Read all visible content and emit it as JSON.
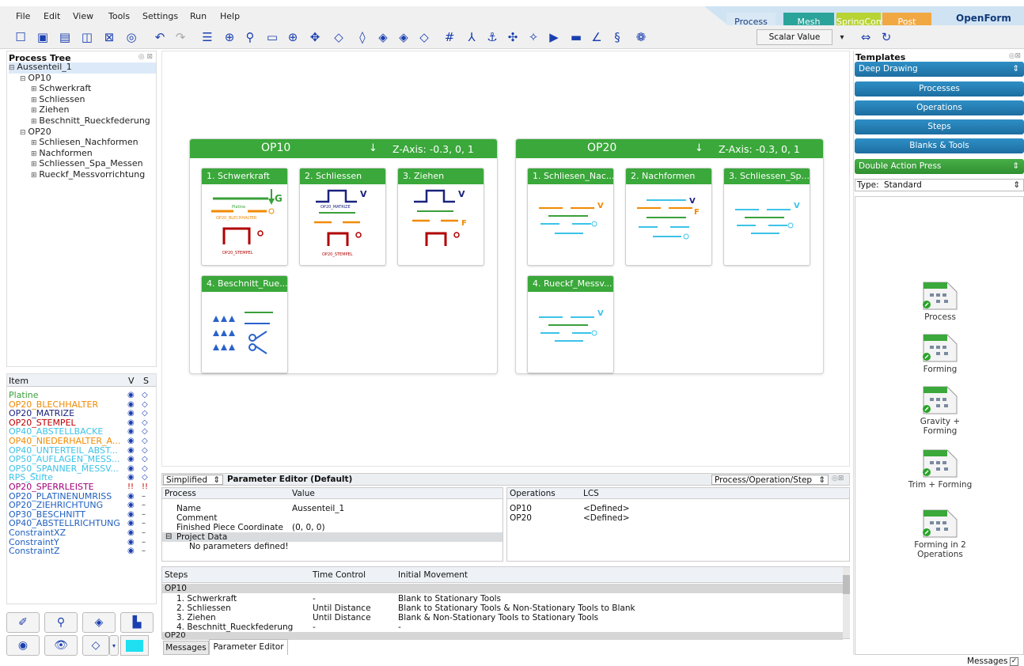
{
  "menubar": {
    "items": [
      "File",
      "Edit",
      "View",
      "Tools",
      "Settings",
      "Run",
      "Help"
    ],
    "tabs": [
      {
        "label": "Process",
        "color": "#d9e8f5",
        "text": "#1b3b7a"
      },
      {
        "label": "Mesh",
        "color": "#2aa39a",
        "text": "#ffffff"
      },
      {
        "label": "SpringComp",
        "color": "#b7d334",
        "text": "#ffffff"
      },
      {
        "label": "Post",
        "color": "#f1a843",
        "text": "#ffffff"
      }
    ],
    "brand": "OpenForm"
  },
  "toolbar": {
    "scalar_label": "Scalar Value"
  },
  "process_tree": {
    "title": "Process Tree",
    "nodes": [
      {
        "label": "Aussenteil_1",
        "level": 0,
        "toggle": "⊟",
        "selected": true
      },
      {
        "label": "OP10",
        "level": 1,
        "toggle": "⊟"
      },
      {
        "label": "Schwerkraft",
        "level": 2,
        "toggle": "⊞"
      },
      {
        "label": "Schliessen",
        "level": 2,
        "toggle": "⊞"
      },
      {
        "label": "Ziehen",
        "level": 2,
        "toggle": "⊞"
      },
      {
        "label": "Beschnitt_Rueckfederung",
        "level": 2,
        "toggle": "⊞"
      },
      {
        "label": "OP20",
        "level": 1,
        "toggle": "⊟"
      },
      {
        "label": "Schliesen_Nachformen",
        "level": 2,
        "toggle": "⊞"
      },
      {
        "label": "Nachformen",
        "level": 2,
        "toggle": "⊞"
      },
      {
        "label": "Schliessen_Spa_Messen",
        "level": 2,
        "toggle": "⊞"
      },
      {
        "label": "Rueckf_Messvorrichtung",
        "level": 2,
        "toggle": "⊞"
      }
    ]
  },
  "items_panel": {
    "headers": {
      "item": "Item",
      "v": "V",
      "s": "S"
    },
    "items": [
      {
        "label": "Platine",
        "color": "#3aa03a",
        "v": "eye",
        "s": "tool"
      },
      {
        "label": "OP20_BLECHHALTER",
        "color": "#f08a00",
        "v": "eye",
        "s": "tool"
      },
      {
        "label": "OP20_MATRIZE",
        "color": "#1a237e",
        "v": "eye",
        "s": "tool"
      },
      {
        "label": "OP20_STEMPEL",
        "color": "#c00000",
        "v": "eye",
        "s": "tool"
      },
      {
        "label": "OP40_ABSTELLBACKE",
        "color": "#3cc3e8",
        "v": "eye",
        "s": "tool"
      },
      {
        "label": "OP40_NIEDERHALTER_A...",
        "color": "#f08a00",
        "v": "eye",
        "s": "tool"
      },
      {
        "label": "OP40_UNTERTEIL_ABST...",
        "color": "#3cc3e8",
        "v": "eye",
        "s": "tool"
      },
      {
        "label": "OP50_AUFLAGEN_MESS...",
        "color": "#3cc3e8",
        "v": "eye",
        "s": "tool"
      },
      {
        "label": "OP50_SPANNER_MESSV...",
        "color": "#3cc3e8",
        "v": "eye",
        "s": "tool"
      },
      {
        "label": "RPS_Stifte",
        "color": "#3cc3e8",
        "v": "eye",
        "s": "tool"
      },
      {
        "label": "OP20_SPERRLEISTE",
        "color": "#a0007a",
        "v": "!!",
        "s": "!!"
      },
      {
        "label": "OP20_PLATINENUMRISS",
        "color": "#1f5fbf",
        "v": "eye",
        "s": "–"
      },
      {
        "label": "OP20_ZIEHRICHTUNG",
        "color": "#1f5fbf",
        "v": "eye",
        "s": "–"
      },
      {
        "label": "OP30_BESCHNITT",
        "color": "#1f5fbf",
        "v": "eye",
        "s": "–"
      },
      {
        "label": "OP40_ABSTELLRICHTUNG",
        "color": "#1f5fbf",
        "v": "eye",
        "s": "–"
      },
      {
        "label": "ConstraintXZ",
        "color": "#1f5fbf",
        "v": "eye",
        "s": "–"
      },
      {
        "label": "ConstraintY",
        "color": "#1f5fbf",
        "v": "eye",
        "s": "–"
      },
      {
        "label": "ConstraintZ",
        "color": "#1f5fbf",
        "v": "eye",
        "s": "–"
      }
    ]
  },
  "canvas": {
    "ops": [
      {
        "title": "OP10",
        "axis": "Z-Axis: -0.3, 0, 1",
        "steps": [
          "1. Schwerkraft",
          "2. Schliessen",
          "3. Ziehen",
          "4. Beschnitt_Rue..."
        ]
      },
      {
        "title": "OP20",
        "axis": "Z-Axis: -0.3, 0, 1",
        "steps": [
          "1. Schliesen_Nac...",
          "2. Nachformen",
          "3. Schliessen_Sp...",
          "4. Rueckf_Messv..."
        ]
      }
    ],
    "card_labels": {
      "g": "G",
      "v": "V",
      "f": "F",
      "platine": "Platine",
      "blechhalter": "OP20_BLECHHALTER",
      "stempel": "OP20_STEMPEL",
      "matrize": "OP20_MATRIZE"
    }
  },
  "templates": {
    "title": "Templates",
    "category": "Deep Drawing",
    "buttons": [
      "Processes",
      "Operations",
      "Steps",
      "Blanks & Tools"
    ],
    "press": "Double Action Press",
    "type_label": "Type:",
    "type_value": "Standard",
    "items": [
      "Process",
      "Forming",
      "Gravity + Forming",
      "Trim + Forming",
      "Forming in 2 Operations"
    ]
  },
  "param_editor": {
    "mode": "Simplified",
    "title": "Parameter Editor (Default)",
    "scope": "Process/Operation/Step",
    "col_process": "Process",
    "col_value": "Value",
    "rows": [
      {
        "label": "Name",
        "value": "Aussenteil_1"
      },
      {
        "label": "Comment",
        "value": ""
      },
      {
        "label": "Finished Piece Coordinate",
        "value": "(0, 0, 0)"
      }
    ],
    "project_data": "Project Data",
    "no_params": "No parameters defined!",
    "ops_header": {
      "operations": "Operations",
      "lcs": "LCS"
    },
    "ops_rows": [
      {
        "op": "OP10",
        "lcs": "<Defined>"
      },
      {
        "op": "OP20",
        "lcs": "<Defined>"
      }
    ]
  },
  "steps_table": {
    "headers": {
      "steps": "Steps",
      "time": "Time Control",
      "move": "Initial Movement"
    },
    "group1": "OP10",
    "rows": [
      {
        "step": "1. Schwerkraft",
        "time": "-",
        "move": "Blank to Stationary Tools"
      },
      {
        "step": "2. Schliessen",
        "time": "Until Distance",
        "move": "Blank to Stationary Tools & Non-Stationary Tools to Blank"
      },
      {
        "step": "3. Ziehen",
        "time": "Until Distance",
        "move": "Blank & Non-Stationary Tools to Stationary Tools"
      },
      {
        "step": "4. Beschnitt_Rueckfederung",
        "time": "-",
        "move": "-"
      }
    ],
    "group2": "OP20"
  },
  "bottom_tabs": [
    "Messages",
    "Parameter Editor"
  ],
  "status": {
    "messages_label": "Messages"
  }
}
